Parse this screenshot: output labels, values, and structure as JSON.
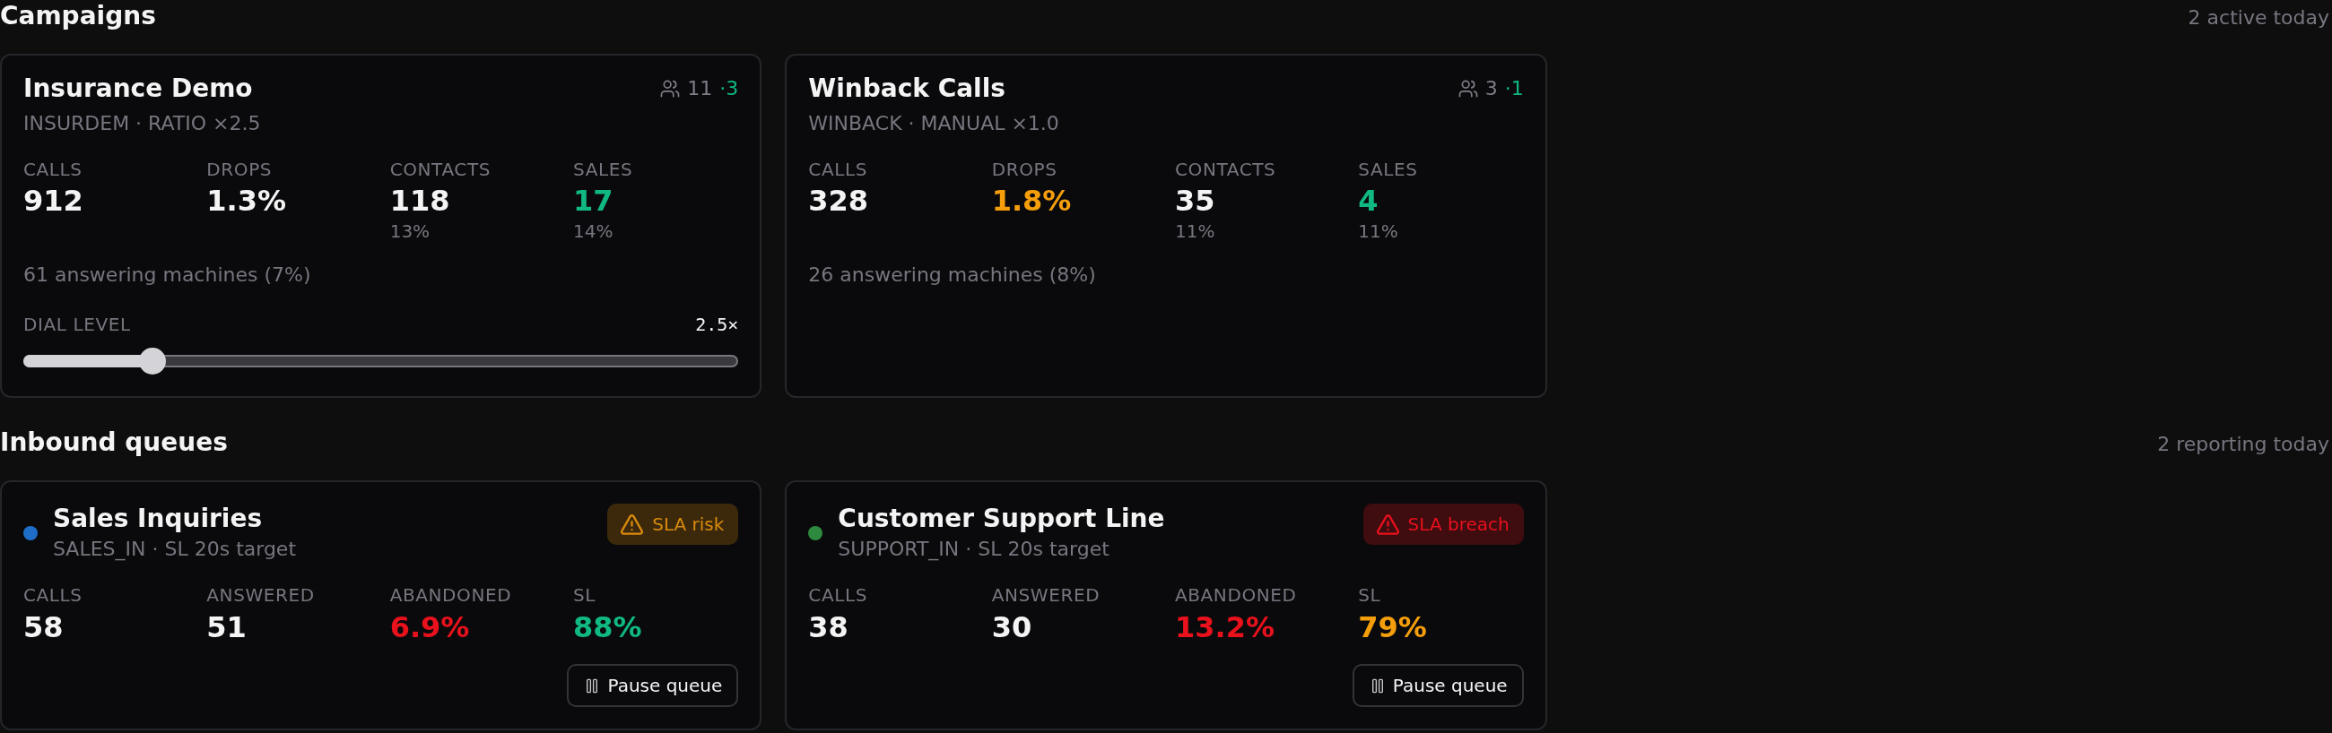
{
  "campaigns": {
    "title": "Campaigns",
    "summary": "2 active today",
    "items": [
      {
        "name": "Insurance Demo",
        "subtitle": "INSURDEM · RATIO ×2.5",
        "agent_count": "11",
        "agent_extra": "·3",
        "stats": [
          {
            "label": "CALLS",
            "value": "912",
            "color": "#f4f4f5"
          },
          {
            "label": "DROPS",
            "value": "1.3%",
            "color": "#f4f4f5"
          },
          {
            "label": "CONTACTS",
            "value": "118",
            "note": "13%",
            "color": "#f4f4f5"
          },
          {
            "label": "SALES",
            "value": "17",
            "note": "14%",
            "color": "#10b981"
          }
        ],
        "footnote": "61 answering machines (7%)",
        "dial": {
          "label": "DIAL LEVEL",
          "reading": "2.5×",
          "level": 0.18
        }
      },
      {
        "name": "Winback Calls",
        "subtitle": "WINBACK · MANUAL ×1.0",
        "agent_count": "3",
        "agent_extra": "·1",
        "stats": [
          {
            "label": "CALLS",
            "value": "328",
            "color": "#f4f4f5"
          },
          {
            "label": "DROPS",
            "value": "1.8%",
            "color": "#f59e0b"
          },
          {
            "label": "CONTACTS",
            "value": "35",
            "note": "11%",
            "color": "#f4f4f5"
          },
          {
            "label": "SALES",
            "value": "4",
            "note": "11%",
            "color": "#10b981"
          }
        ],
        "footnote": "26 answering machines (8%)"
      }
    ]
  },
  "inbound_queues": {
    "title": "Inbound queues",
    "summary": "2 reporting today",
    "items": [
      {
        "name": "Sales Inquiries",
        "color": "#1e6ec8",
        "subtitle": "SALES_IN · SL 20s target",
        "badge": {
          "label": "SLA risk",
          "color": "#d98a0b"
        },
        "stats": [
          {
            "label": "CALLS",
            "value": "58",
            "color": "#f4f4f5"
          },
          {
            "label": "ANSWERED",
            "value": "51",
            "color": "#f4f4f5"
          },
          {
            "label": "ABANDONED",
            "value": "6.9%",
            "color": "#e8111c"
          },
          {
            "label": "SL",
            "value": "88%",
            "color": "#10b981"
          }
        ],
        "action": "Pause queue"
      },
      {
        "name": "Customer Support Line",
        "color": "#2d8a3e",
        "subtitle": "SUPPORT_IN · SL 20s target",
        "badge": {
          "label": "SLA breach",
          "color": "#e8111c"
        },
        "stats": [
          {
            "label": "CALLS",
            "value": "38",
            "color": "#f4f4f5"
          },
          {
            "label": "ANSWERED",
            "value": "30",
            "color": "#f4f4f5"
          },
          {
            "label": "ABANDONED",
            "value": "13.2%",
            "color": "#e8111c"
          },
          {
            "label": "SL",
            "value": "79%",
            "color": "#f59e0b"
          }
        ],
        "action": "Pause queue"
      }
    ]
  }
}
